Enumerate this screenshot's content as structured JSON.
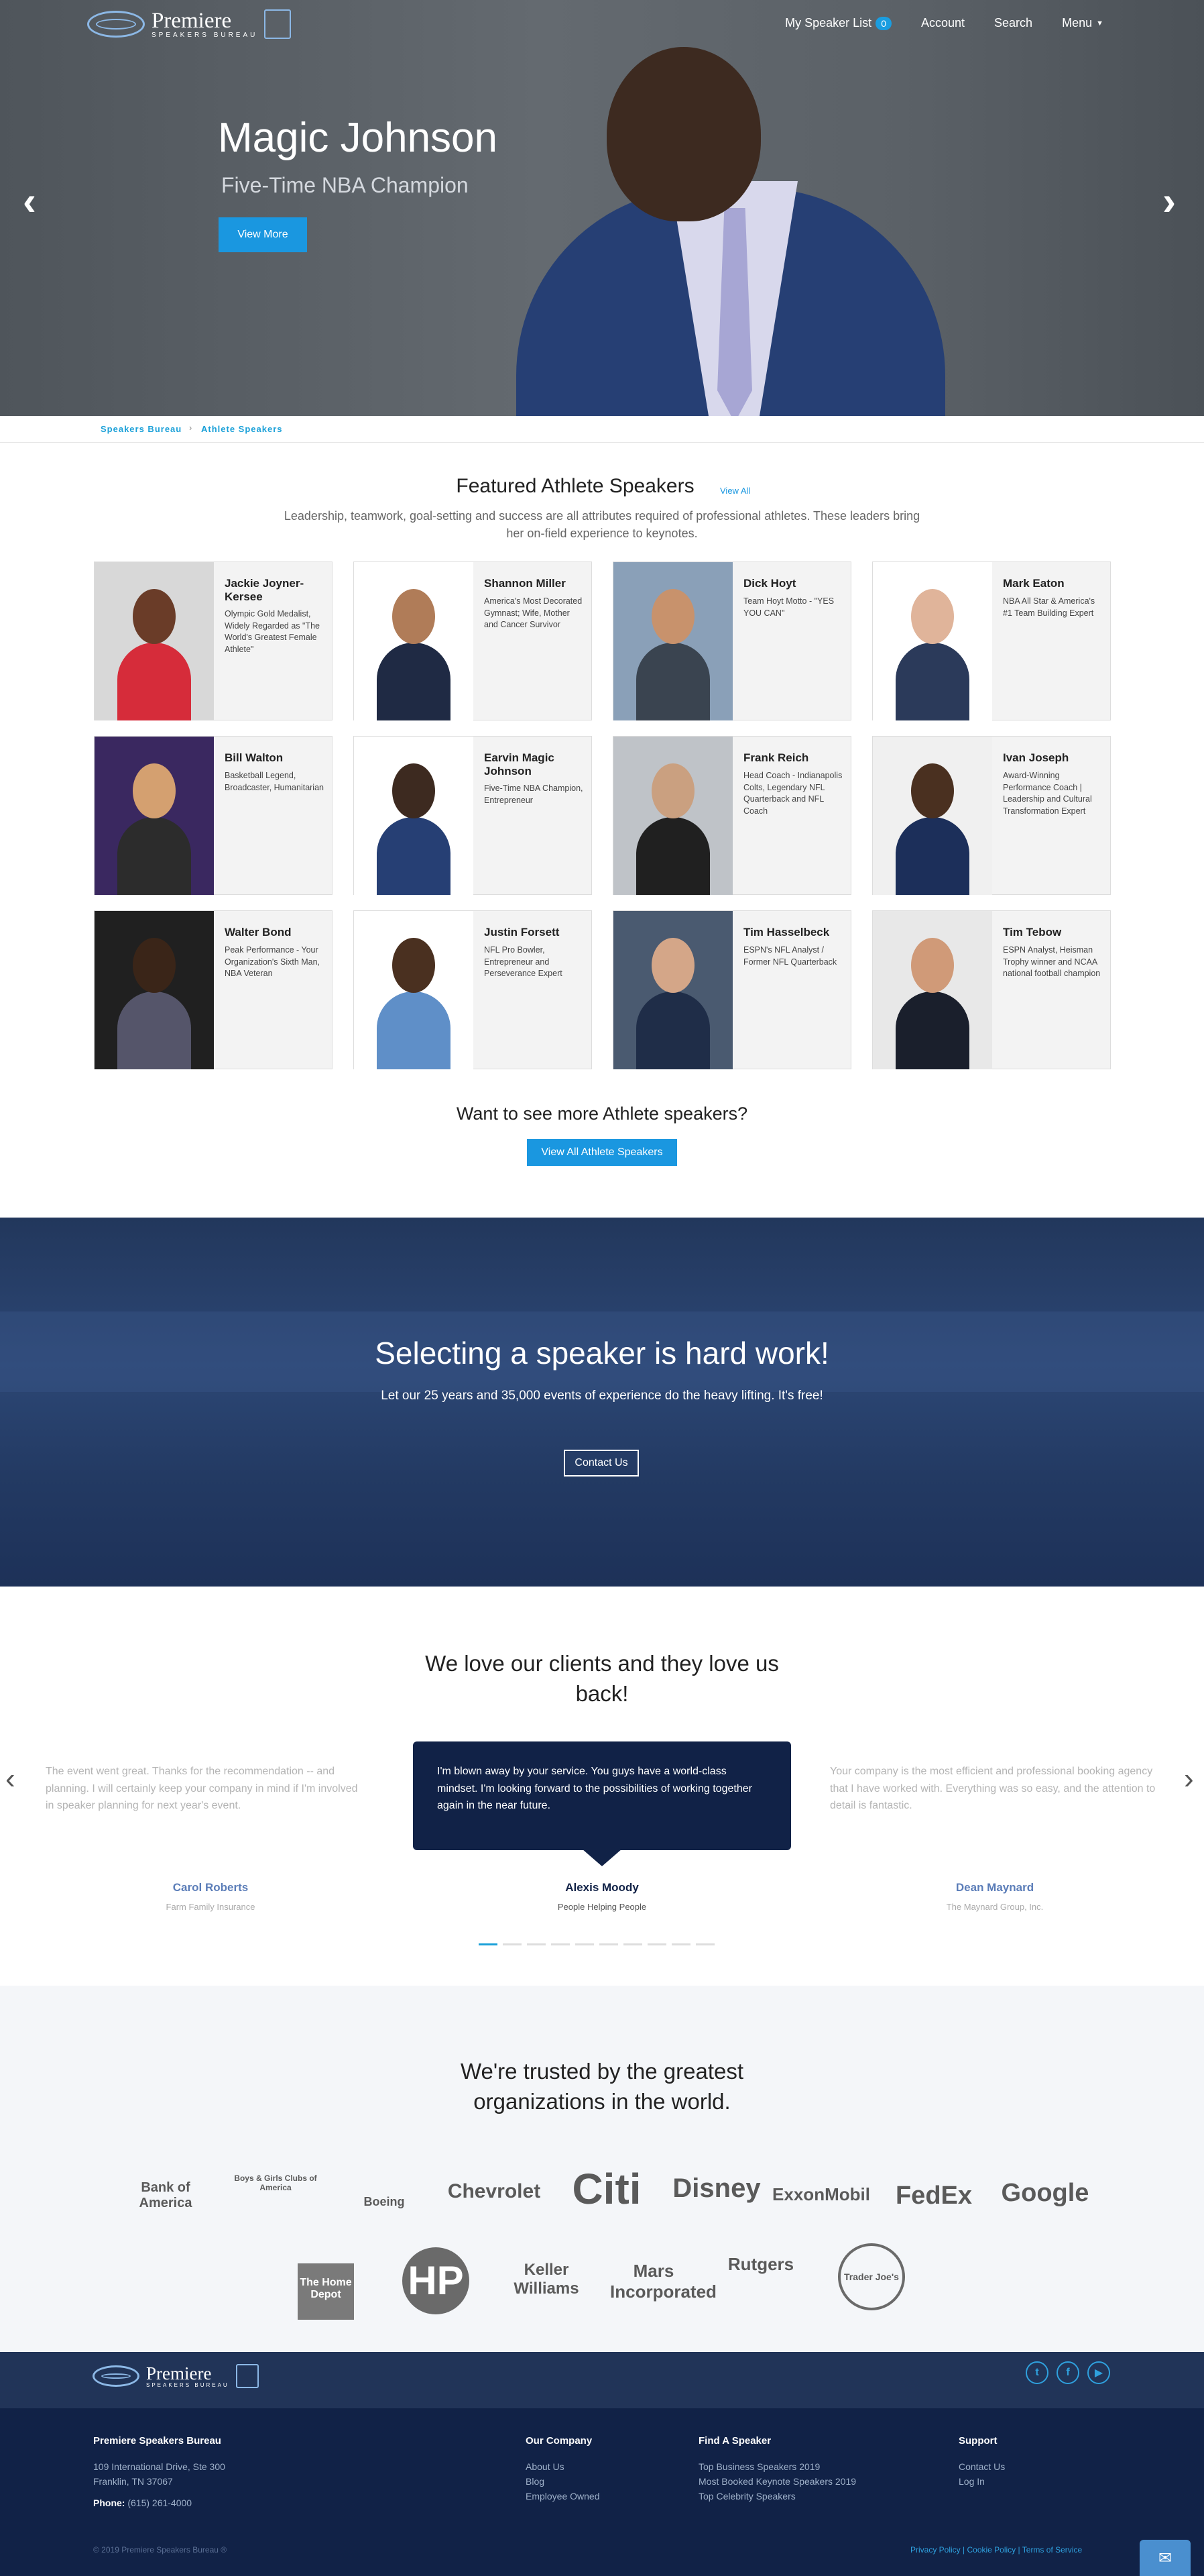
{
  "nav": {
    "logo_word": "Premiere",
    "logo_sub": "SPEAKERS BUREAU",
    "my_speaker_list": "My Speaker List",
    "list_count": "0",
    "account": "Account",
    "search": "Search",
    "menu": "Menu"
  },
  "hero": {
    "name": "Magic Johnson",
    "subtitle": "Five-Time NBA Champion",
    "button": "View More",
    "prev_icon": "chevron-left-icon",
    "next_icon": "chevron-right-icon"
  },
  "breadcrumb": {
    "home": "Speakers Bureau",
    "current": "Athlete Speakers"
  },
  "featured": {
    "title": "Featured Athlete Speakers",
    "view_all": "View All",
    "intro": "Leadership, teamwork, goal-setting and success are all attributes required of professional athletes. These leaders bring her on-field experience to keynotes.",
    "speakers": [
      {
        "name": "Jackie Joyner-Kersee",
        "desc": "Olympic Gold Medalist, Widely Regarded as \"The World's Greatest Female Athlete\""
      },
      {
        "name": "Shannon Miller",
        "desc": "America's Most Decorated Gymnast; Wife, Mother and Cancer Survivor"
      },
      {
        "name": "Dick Hoyt",
        "desc": "Team Hoyt Motto - \"YES YOU CAN\""
      },
      {
        "name": "Mark Eaton",
        "desc": "NBA All Star & America's #1 Team Building Expert"
      },
      {
        "name": "Bill Walton",
        "desc": "Basketball Legend, Broadcaster, Humanitarian"
      },
      {
        "name": "Earvin Magic Johnson",
        "desc": "Five-Time NBA Champion, Entrepreneur"
      },
      {
        "name": "Frank Reich",
        "desc": "Head Coach - Indianapolis Colts, Legendary NFL Quarterback and NFL Coach"
      },
      {
        "name": "Ivan Joseph",
        "desc": "Award-Winning Performance Coach | Leadership and Cultural Transformation Expert"
      },
      {
        "name": "Walter Bond",
        "desc": "Peak Performance - Your Organization's Sixth Man, NBA Veteran"
      },
      {
        "name": "Justin Forsett",
        "desc": "NFL Pro Bowler, Entrepreneur and Perseverance Expert"
      },
      {
        "name": "Tim Hasselbeck",
        "desc": "ESPN's NFL Analyst / Former NFL Quarterback"
      },
      {
        "name": "Tim Tebow",
        "desc": "ESPN Analyst, Heisman Trophy winner and NCAA national football champion"
      }
    ],
    "more_title": "Want to see more Athlete speakers?",
    "more_button": "View All Athlete Speakers"
  },
  "cta": {
    "title": "Selecting a speaker is hard work!",
    "text": "Let our 25 years and 35,000 events of experience do the heavy lifting. It's free!",
    "button": "Contact Us"
  },
  "testimonials": {
    "title": "We love our clients and they love us back!",
    "items": [
      {
        "quote": "The event went great. Thanks for the recommendation -- and planning. I will certainly keep your company in mind if I'm involved in speaker planning for next year's event.",
        "name": "Carol Roberts",
        "company": "Farm Family Insurance"
      },
      {
        "quote": "I'm blown away by your service. You guys have a world-class mindset. I'm looking forward to the possibilities of working together again in the near future.",
        "name": "Alexis Moody",
        "company": "People Helping People"
      },
      {
        "quote": "Your company is the most efficient and professional booking agency that I have worked with. Everything was so easy, and the attention to detail is fantastic.",
        "name": "Dean Maynard",
        "company": "The Maynard Group, Inc."
      }
    ],
    "active_dot": 0
  },
  "trusted": {
    "title": "We're trusted by the greatest organizations in the world.",
    "logos": [
      "Bank of America",
      "Boys & Girls Clubs of America",
      "Boeing",
      "Chevrolet",
      "Citi",
      "Disney",
      "ExxonMobil",
      "FedEx",
      "Google",
      "The Home Depot",
      "HP",
      "Keller Williams",
      "Mars Incorporated",
      "Rutgers",
      "Trader Joe's"
    ]
  },
  "footer": {
    "company": "Premiere Speakers Bureau",
    "address1": "109 International Drive, Ste 300",
    "address2": "Franklin, TN 37067",
    "phone_label": "Phone:",
    "phone": "(615) 261-4000",
    "copyright": "© 2019 Premiere Speakers Bureau ®",
    "our_company": {
      "title": "Our Company",
      "links": [
        "About Us",
        "Blog",
        "Employee Owned"
      ]
    },
    "find_speaker": {
      "title": "Find A Speaker",
      "links": [
        "Top Business Speakers 2019",
        "Most Booked Keynote Speakers 2019",
        "Top Celebrity Speakers"
      ]
    },
    "support": {
      "title": "Support",
      "links": [
        "Contact Us",
        "Log In"
      ]
    },
    "legal": [
      "Privacy Policy",
      "Cookie Policy",
      "Terms of Service"
    ]
  },
  "colors": {
    "accent": "#1a97e0",
    "navy": "#112247",
    "hero": "#5b6167"
  }
}
